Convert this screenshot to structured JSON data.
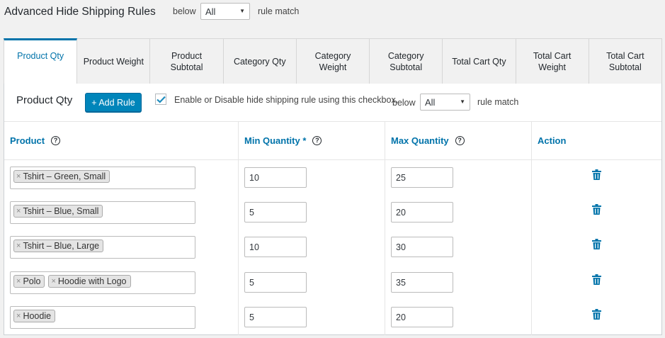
{
  "header": {
    "title": "Advanced Hide Shipping Rules",
    "below_label": "below",
    "match_select": "All",
    "rule_match_label": "rule match"
  },
  "tabs": [
    {
      "label": "Product Qty",
      "active": true
    },
    {
      "label": "Product Weight"
    },
    {
      "label": "Product Subtotal"
    },
    {
      "label": "Category Qty"
    },
    {
      "label": "Category Weight"
    },
    {
      "label": "Category Subtotal"
    },
    {
      "label": "Total Cart Qty"
    },
    {
      "label": "Total Cart Weight"
    },
    {
      "label": "Total Cart Subtotal"
    }
  ],
  "panel": {
    "title": "Product Qty",
    "add_rule_label": "+ Add Rule",
    "checkbox_checked": true,
    "enable_text": "Enable or Disable hide shipping rule using this checkbox.",
    "below_label": "below",
    "match_select": "All",
    "rule_match_label": "rule match"
  },
  "table": {
    "headers": {
      "product": "Product",
      "min_qty": "Min Quantity *",
      "max_qty": "Max Quantity",
      "action": "Action"
    },
    "rows": [
      {
        "products": [
          "Tshirt – Green, Small"
        ],
        "min": "10",
        "max": "25"
      },
      {
        "products": [
          "Tshirt – Blue, Small"
        ],
        "min": "5",
        "max": "20"
      },
      {
        "products": [
          "Tshirt – Blue, Large"
        ],
        "min": "10",
        "max": "30"
      },
      {
        "products": [
          "Polo",
          "Hoodie with Logo"
        ],
        "min": "5",
        "max": "35"
      },
      {
        "products": [
          "Hoodie"
        ],
        "min": "5",
        "max": "20"
      }
    ]
  },
  "colors": {
    "accent": "#0073aa",
    "button": "#0085ba",
    "background": "#f1f1f1"
  },
  "icons": {
    "remove_tag": "×",
    "delete": "trash-icon",
    "help": "?",
    "caret": "▼"
  }
}
